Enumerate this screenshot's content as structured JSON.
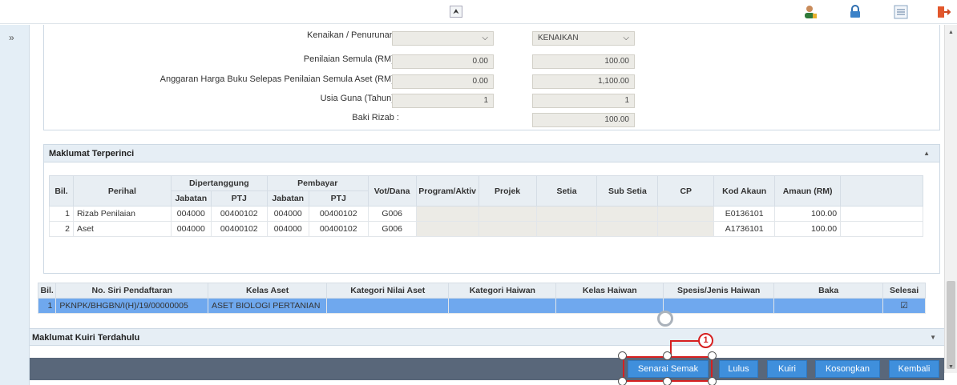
{
  "form": {
    "kenaikan_label": "Kenaikan / Penurunan :",
    "kenaikan_left": "",
    "kenaikan_right": "KENAIKAN",
    "penilaian_label": "Penilaian Semula (RM) :",
    "penilaian_left": "0.00",
    "penilaian_right": "100.00",
    "anggaran_label": "Anggaran Harga Buku Selepas Penilaian Semula Aset (RM) :",
    "anggaran_left": "0.00",
    "anggaran_right": "1,100.00",
    "usia_label": "Usia Guna (Tahun) :",
    "usia_left": "1",
    "usia_right": "1",
    "baki_label": "Baki Rizab :",
    "baki_right": "100.00"
  },
  "detail": {
    "title": "Maklumat Terperinci",
    "headers": {
      "bil": "Bil.",
      "perihal": "Perihal",
      "dipertanggung": "Dipertanggung",
      "pembayar": "Pembayar",
      "jabatan": "Jabatan",
      "ptj": "PTJ",
      "vot": "Vot/Dana",
      "program": "Program/Aktiv",
      "projek": "Projek",
      "setia": "Setia",
      "subsetia": "Sub Setia",
      "cp": "CP",
      "kod": "Kod Akaun",
      "amaun": "Amaun (RM)"
    },
    "rows": [
      {
        "bil": "1",
        "perihal": "Rizab Penilaian",
        "jab1": "004000",
        "ptj1": "00400102",
        "jab2": "004000",
        "ptj2": "00400102",
        "vot": "G006",
        "kod": "E0136101",
        "amaun": "100.00"
      },
      {
        "bil": "2",
        "perihal": "Aset",
        "jab1": "004000",
        "ptj1": "00400102",
        "jab2": "004000",
        "ptj2": "00400102",
        "vot": "G006",
        "kod": "A1736101",
        "amaun": "100.00"
      }
    ]
  },
  "registry": {
    "headers": {
      "bil": "Bil.",
      "siri": "No. Siri Pendaftaran",
      "kelas": "Kelas Aset",
      "kategori_nilai": "Kategori Nilai Aset",
      "kategori_haiwan": "Kategori Haiwan",
      "kelas_haiwan": "Kelas Haiwan",
      "spesis": "Spesis/Jenis Haiwan",
      "baka": "Baka",
      "selesai": "Selesai"
    },
    "row": {
      "bil": "1",
      "siri": "PKNPK/BHGBN/I(H)/19/00000005",
      "kelas": "ASET BIOLOGI PERTANIAN",
      "selesai": "☑"
    }
  },
  "kuiri": {
    "title": "Maklumat Kuiri Terdahulu"
  },
  "actions": {
    "senarai_semak": "Senarai Semak",
    "lulus": "Lulus",
    "kuiri": "Kuiri",
    "kosongkan": "Kosongkan",
    "kembali": "Kembali"
  },
  "annotation": {
    "badge": "1"
  }
}
